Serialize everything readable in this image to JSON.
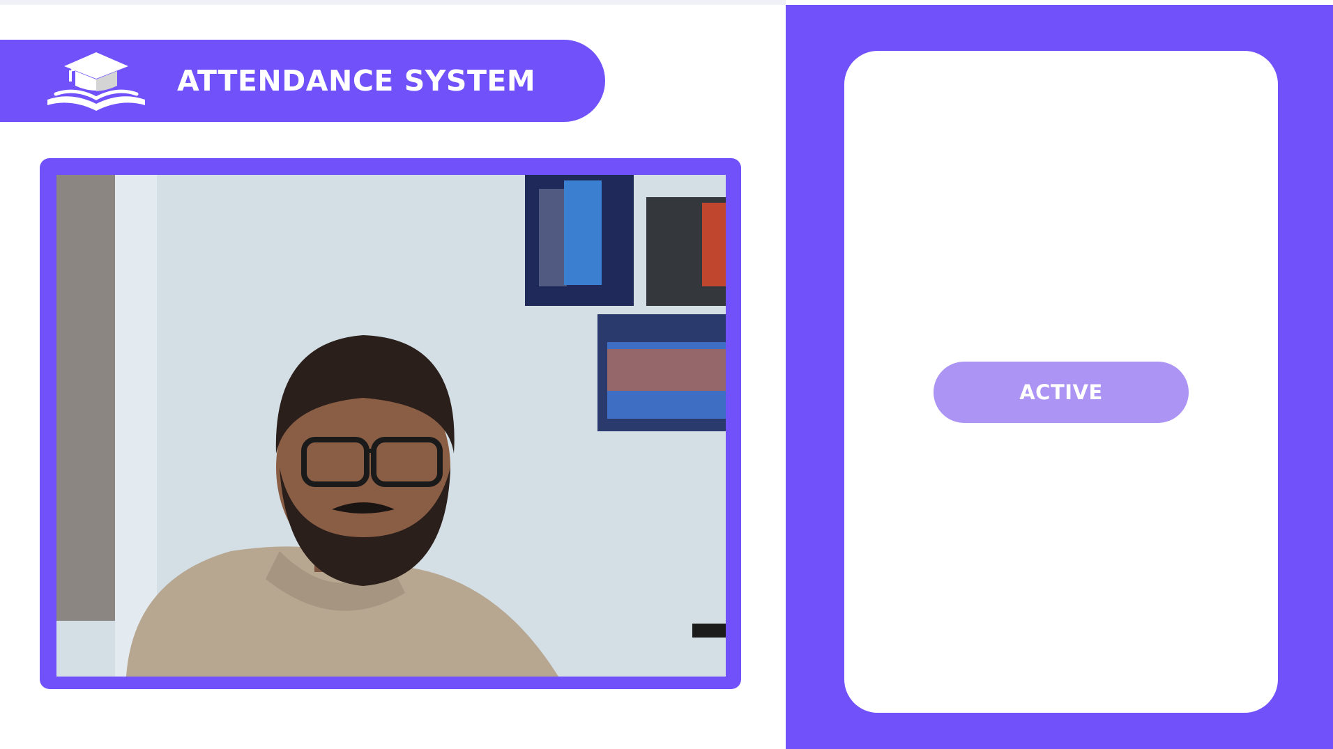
{
  "app": {
    "title": "ATTENDANCE SYSTEM",
    "logo_icon": "graduation-cap-book-icon"
  },
  "camera": {
    "feed_description_icon": "webcam-feed"
  },
  "status": {
    "label": "ACTIVE"
  },
  "colors": {
    "accent": "#7152fa",
    "badge": "#ab94f3",
    "background": "#ffffff"
  }
}
